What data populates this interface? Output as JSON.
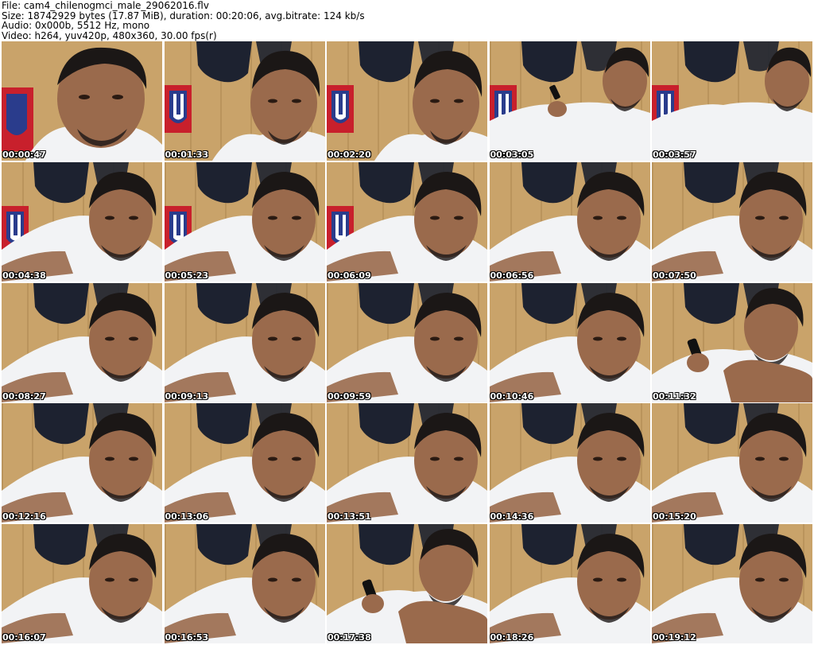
{
  "header": {
    "file": "File: cam4_chilenogmci_male_29062016.flv",
    "size": "Size: 18742929 bytes (17.87 MiB), duration: 00:20:06, avg.bitrate: 124 kb/s",
    "audio": "Audio: 0x000b, 5512 Hz, mono",
    "video": "Video: h264, yuv420p, 480x360, 30.00 fps(r)"
  },
  "thumbnails": [
    {
      "time": "00:00:47",
      "scene": "close-face",
      "banner": true
    },
    {
      "time": "00:01:33",
      "scene": "face-right",
      "banner": true
    },
    {
      "time": "00:02:20",
      "scene": "face-right",
      "banner": true
    },
    {
      "time": "00:03:05",
      "scene": "reclined-phone",
      "banner": true
    },
    {
      "time": "00:03:57",
      "scene": "reclined",
      "banner": true
    },
    {
      "time": "00:04:38",
      "scene": "lying",
      "banner": true
    },
    {
      "time": "00:05:23",
      "scene": "lying",
      "banner": true
    },
    {
      "time": "00:06:09",
      "scene": "lying",
      "banner": true
    },
    {
      "time": "00:06:56",
      "scene": "lying",
      "banner": false
    },
    {
      "time": "00:07:50",
      "scene": "lying",
      "banner": false
    },
    {
      "time": "00:08:27",
      "scene": "lying",
      "banner": false
    },
    {
      "time": "00:09:13",
      "scene": "lying",
      "banner": false
    },
    {
      "time": "00:09:59",
      "scene": "lying",
      "banner": false
    },
    {
      "time": "00:10:46",
      "scene": "lying",
      "banner": false
    },
    {
      "time": "00:11:32",
      "scene": "phone-hand",
      "banner": false
    },
    {
      "time": "00:12:16",
      "scene": "lying",
      "banner": false
    },
    {
      "time": "00:13:06",
      "scene": "lying",
      "banner": false
    },
    {
      "time": "00:13:51",
      "scene": "lying",
      "banner": false
    },
    {
      "time": "00:14:36",
      "scene": "lying",
      "banner": false
    },
    {
      "time": "00:15:20",
      "scene": "lying",
      "banner": false
    },
    {
      "time": "00:16:07",
      "scene": "lying",
      "banner": false
    },
    {
      "time": "00:16:53",
      "scene": "lying",
      "banner": false
    },
    {
      "time": "00:17:38",
      "scene": "phone-hand",
      "banner": false
    },
    {
      "time": "00:18:26",
      "scene": "lying",
      "banner": false
    },
    {
      "time": "00:19:12",
      "scene": "lying",
      "banner": false
    }
  ],
  "colors": {
    "wall": "#c9a36a",
    "wall_dark": "#a8824c",
    "shirt": "#f2f3f5",
    "skin": "#9a6a4c",
    "skin_dark": "#6e4630",
    "hair": "#1b1716",
    "clothes": "#1d2230",
    "banner_red": "#c8202c",
    "banner_blue": "#2a3c8c"
  }
}
